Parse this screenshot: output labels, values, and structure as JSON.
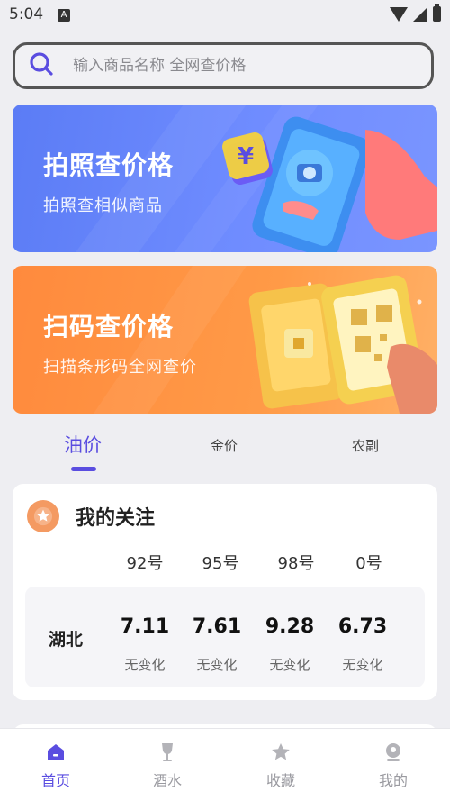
{
  "status": {
    "time": "5:04",
    "notif": "A"
  },
  "search": {
    "placeholder": "输入商品名称 全网查价格"
  },
  "banners": [
    {
      "title": "拍照查价格",
      "subtitle": "拍照查相似商品",
      "art_glyph": "¥"
    },
    {
      "title": "扫码查价格",
      "subtitle": "扫描条形码全网查价"
    }
  ],
  "tabs": [
    {
      "label": "油价",
      "active": true
    },
    {
      "label": "金价",
      "active": false
    },
    {
      "label": "农副",
      "active": false
    }
  ],
  "watch": {
    "title": "我的关注",
    "columns": [
      "92号",
      "95号",
      "98号",
      "0号"
    ],
    "region": "湖北",
    "prices": [
      "7.11",
      "7.61",
      "9.28",
      "6.73"
    ],
    "changes": [
      "无变化",
      "无变化",
      "无变化",
      "无变化"
    ]
  },
  "nav": [
    {
      "label": "首页",
      "icon": "home-icon",
      "active": true
    },
    {
      "label": "酒水",
      "icon": "wine-glass-icon",
      "active": false
    },
    {
      "label": "收藏",
      "icon": "star-icon",
      "active": false
    },
    {
      "label": "我的",
      "icon": "user-icon",
      "active": false
    }
  ],
  "colors": {
    "accent": "#5a4de0",
    "blue_banner": "#6f8cff",
    "orange_banner": "#ff9a47"
  }
}
